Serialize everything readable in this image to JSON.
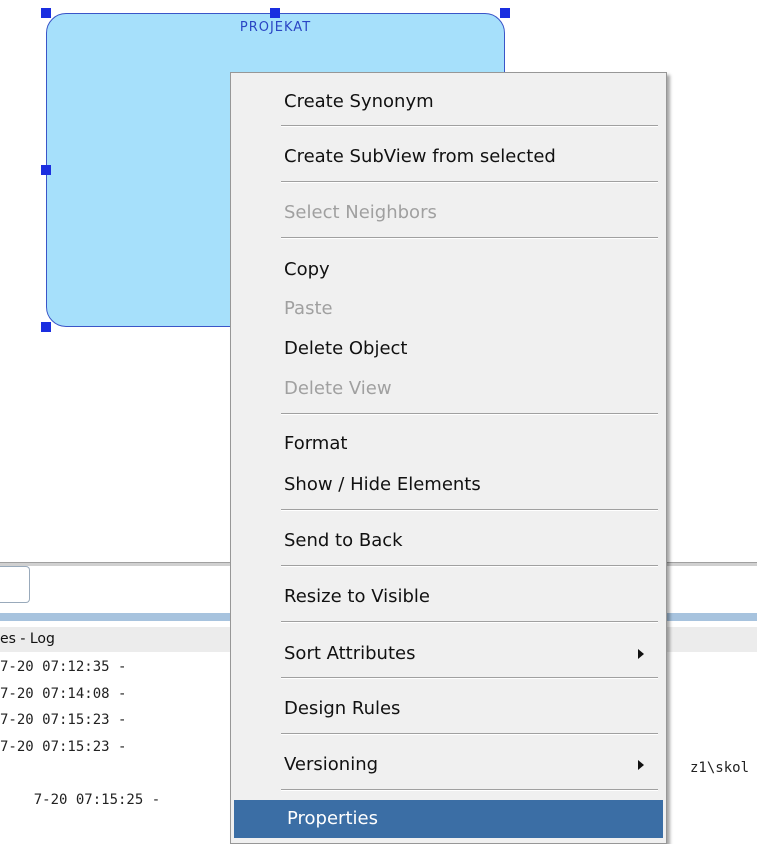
{
  "entity": {
    "title": "PROJEKAT"
  },
  "log": {
    "title": "es - Log",
    "lines": [
      "7-20 07:12:35 -",
      "7-20 07:14:08 -",
      "7-20 07:15:23 -",
      "7-20 07:15:23 -",
      "7-20 07:15:25 -"
    ],
    "right_text": "z1\\skol"
  },
  "menu": {
    "create_synonym": "Create Synonym",
    "create_subview": "Create SubView from selected",
    "select_neighbors": "Select Neighbors",
    "copy": "Copy",
    "paste": "Paste",
    "delete_object": "Delete Object",
    "delete_view": "Delete View",
    "format": "Format",
    "show_hide": "Show / Hide Elements",
    "send_to_back": "Send to Back",
    "resize_to_visible": "Resize to Visible",
    "sort_attributes": "Sort Attributes",
    "design_rules": "Design Rules",
    "versioning": "Versioning",
    "properties": "Properties"
  },
  "colors": {
    "entity_fill": "#a6e0fb",
    "selection": "#3b6ea5"
  }
}
